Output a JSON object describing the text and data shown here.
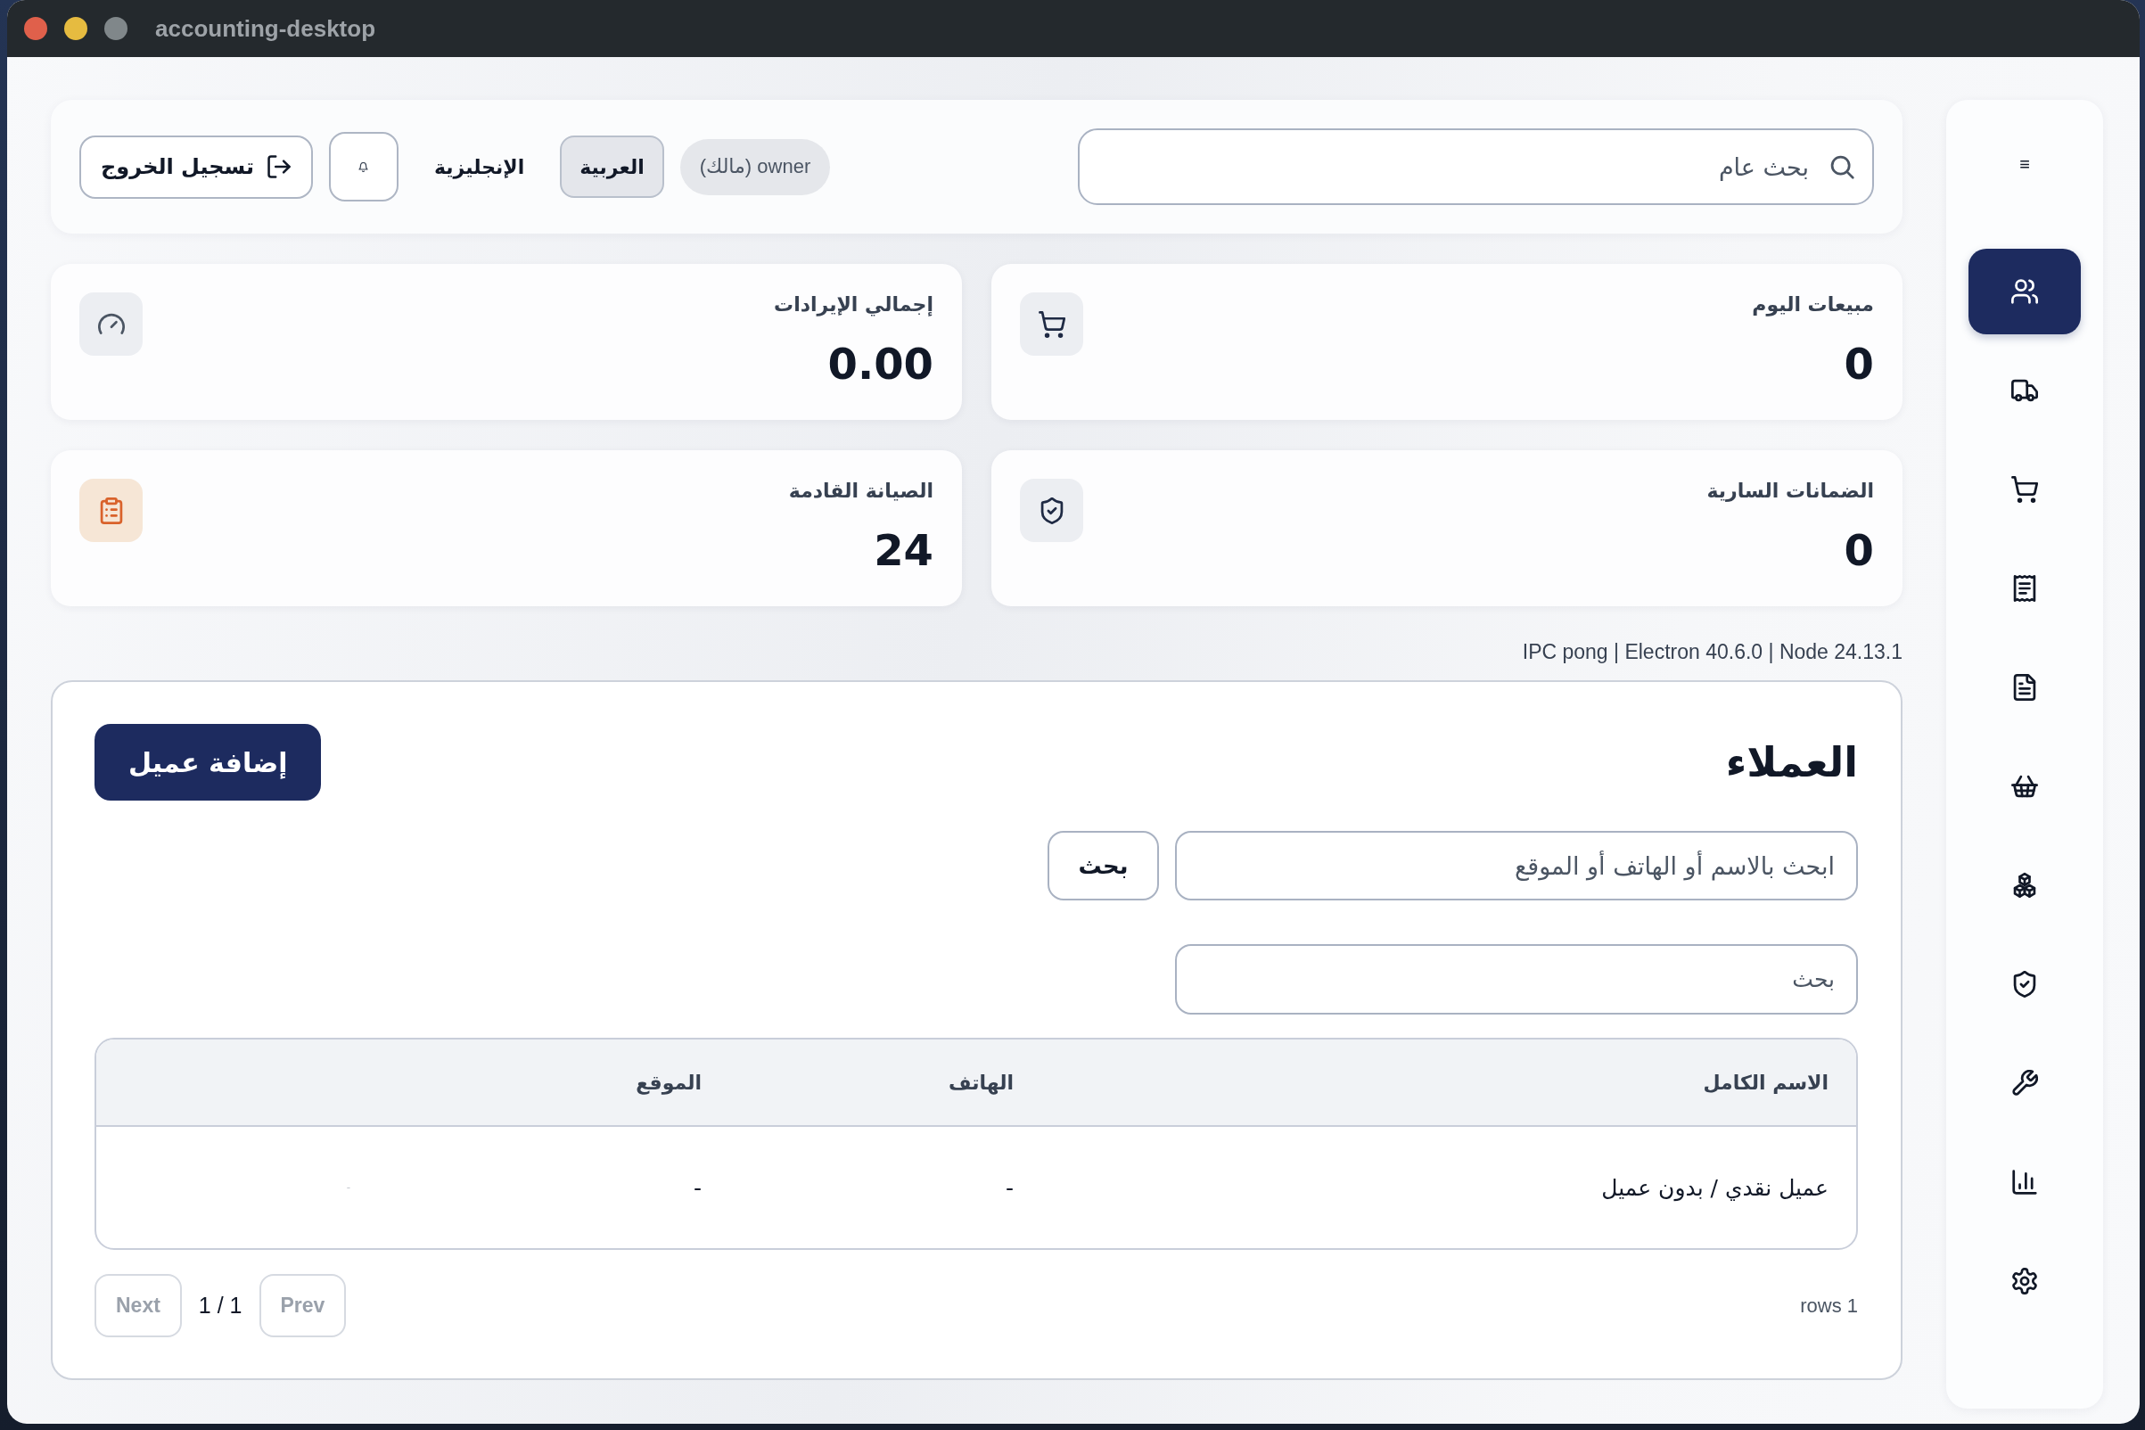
{
  "window": {
    "title": "accounting-desktop"
  },
  "sidebar": {
    "menu_glyph": "≡",
    "items": [
      {
        "kind": "customers",
        "selected": true
      },
      {
        "kind": "suppliers",
        "selected": false
      },
      {
        "kind": "sales",
        "selected": false
      },
      {
        "kind": "invoices",
        "selected": false
      },
      {
        "kind": "documents",
        "selected": false
      },
      {
        "kind": "purchases",
        "selected": false
      },
      {
        "kind": "inventory",
        "selected": false
      },
      {
        "kind": "warranties",
        "selected": false
      },
      {
        "kind": "maintenance",
        "selected": false
      },
      {
        "kind": "reports",
        "selected": false
      },
      {
        "kind": "settings",
        "selected": false
      }
    ]
  },
  "header": {
    "search": {
      "placeholder": "بحث عام"
    },
    "user_badge": "owner (مالك)",
    "languages": [
      {
        "label": "العربية",
        "selected": true
      },
      {
        "label": "الإنجليزية",
        "selected": false
      }
    ],
    "logout_button": "تسجيل الخروج"
  },
  "stats": [
    {
      "kind": "sales",
      "title": "مبيعات اليوم",
      "value": "0"
    },
    {
      "kind": "revenue",
      "title": "إجمالي الإيرادات",
      "value": "0.00"
    },
    {
      "kind": "warranties",
      "title": "الضمانات السارية",
      "value": "0"
    },
    {
      "kind": "maintenance",
      "title": "الصيانة القادمة",
      "value": "24"
    }
  ],
  "version_info": "IPC pong | Electron 40.6.0 | Node 24.13.1",
  "customers": {
    "title": "العملاء",
    "add_button": "إضافة عميل",
    "search": {
      "placeholder": "ابحث بالاسم أو الهاتف أو الموقع"
    },
    "search_button": "بحث",
    "filter": {
      "placeholder": "بحث"
    },
    "table": {
      "columns": [
        "الاسم الكامل",
        "الهاتف",
        "الموقع"
      ],
      "rows": [
        [
          "عميل نقدي / بدون عميل",
          "-",
          "-",
          "-"
        ]
      ]
    },
    "pagination": {
      "rows_label": "rows 1",
      "prev": {
        "label": "Prev",
        "disabled": true
      },
      "page": "1 / 1",
      "next": {
        "label": "Next",
        "disabled": true
      }
    }
  }
}
